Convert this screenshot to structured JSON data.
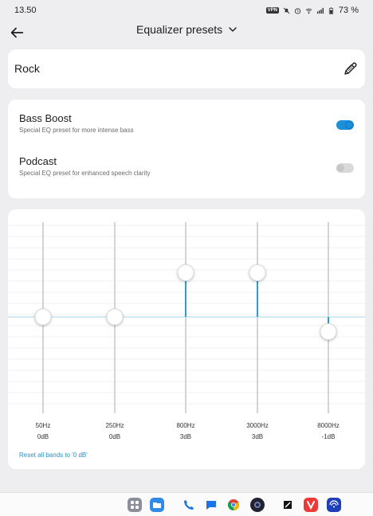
{
  "status_bar": {
    "time": "13.50",
    "vpn": "VPN",
    "battery": "73 %",
    "icons": [
      "vpn-icon",
      "mute-icon",
      "alarm-icon",
      "wifi-icon",
      "signal-icon",
      "battery-icon"
    ]
  },
  "header": {
    "title": "Equalizer presets",
    "back_icon": "arrow-left-icon",
    "dropdown_icon": "chevron-down-icon"
  },
  "preset": {
    "name": "Rock",
    "edit_icon": "pencil-icon"
  },
  "toggles": [
    {
      "title": "Bass Boost",
      "subtitle": "Special EQ preset for more intense bass",
      "enabled": true
    },
    {
      "title": "Podcast",
      "subtitle": "Special EQ preset for enhanced speech clarity",
      "enabled": false
    }
  ],
  "equalizer": {
    "bands": [
      {
        "freq": "50Hz",
        "gain": "0dB",
        "value": 0
      },
      {
        "freq": "250Hz",
        "gain": "0dB",
        "value": 0
      },
      {
        "freq": "800Hz",
        "gain": "3dB",
        "value": 3
      },
      {
        "freq": "3000Hz",
        "gain": "3dB",
        "value": 3
      },
      {
        "freq": "8000Hz",
        "gain": "-1dB",
        "value": -1
      }
    ],
    "range_db": [
      -10,
      10
    ],
    "reset_label": "Reset all bands to '0 dB'",
    "accent": "#2a9fd8"
  },
  "dock": {
    "apps": [
      "app-drawer-icon",
      "files-icon",
      "phone-icon",
      "messages-icon",
      "chrome-icon",
      "camera-icon",
      "notes-icon",
      "vivaldi-icon",
      "wireless-icon"
    ]
  }
}
